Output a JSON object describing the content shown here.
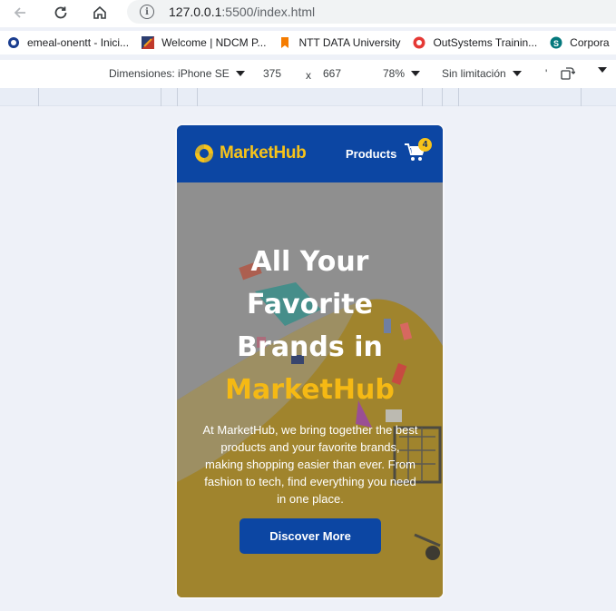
{
  "browser": {
    "url_host": "127.0.0.1",
    "url_path": ":5500/index.html",
    "bookmarks": [
      {
        "label": "emeal-onentt - Inici...",
        "icon": "circle-logo-icon",
        "color": "#1a3d8f"
      },
      {
        "label": "Welcome | NDCM P...",
        "icon": "ndcm-logo-icon",
        "color": "#c0392b"
      },
      {
        "label": "NTT DATA University",
        "icon": "bookmark-icon",
        "color": "#f57c00"
      },
      {
        "label": "OutSystems Trainin...",
        "icon": "outsystems-icon",
        "color": "#e53935"
      },
      {
        "label": "Corpora",
        "icon": "sharepoint-icon",
        "color": "#03787c"
      }
    ]
  },
  "devtools": {
    "dimensions_label": "Dimensiones: iPhone SE",
    "width": "375",
    "times": "x",
    "height": "667",
    "zoom": "78%",
    "throttle": "Sin limitación",
    "dot": "'"
  },
  "site": {
    "logo_text": "MarketHub",
    "nav_products": "Products",
    "cart_count": "4",
    "hero": {
      "title_line1": "All Your",
      "title_line2": "Favorite",
      "title_line3": "Brands in",
      "title_accent": "MarketHub",
      "text": "At MarketHub, we bring together the best products and your favorite brands, making shopping easier than ever. From fashion to tech, find everything you need in one place.",
      "cta": "Discover More"
    }
  },
  "colors": {
    "header": "#0c46a3",
    "accent": "#f7c31a",
    "hero_bg": "#a0842d"
  }
}
